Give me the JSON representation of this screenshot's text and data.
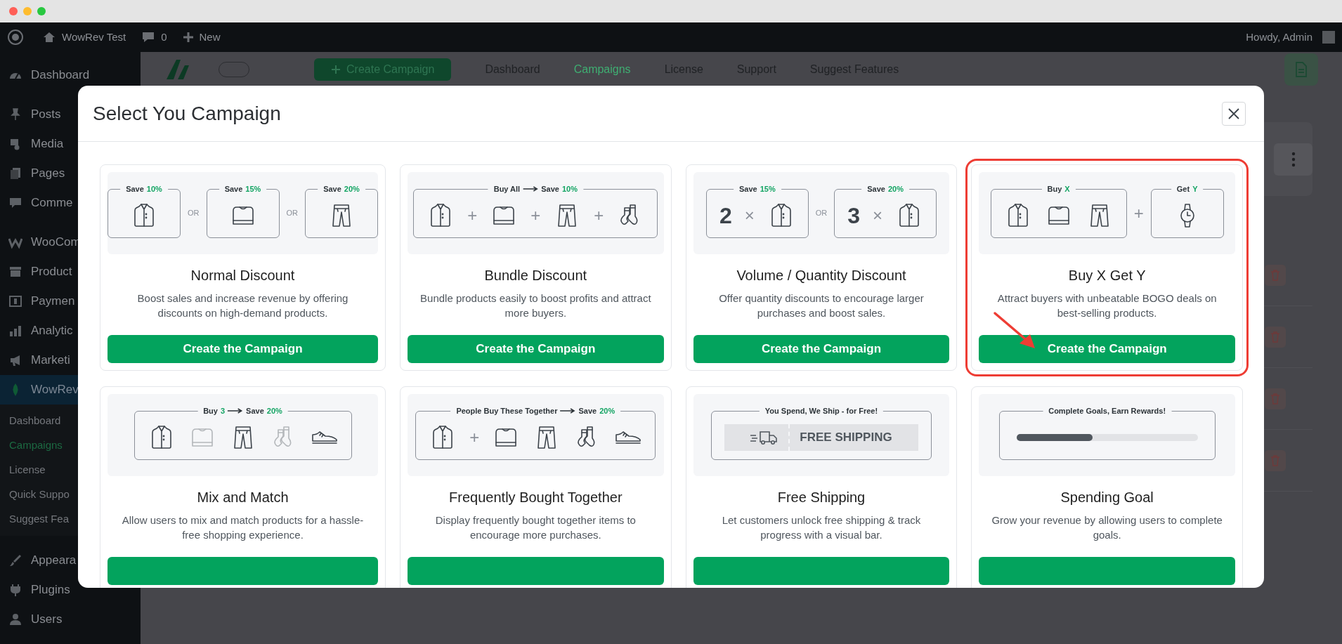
{
  "admin_bar": {
    "site_name": "WowRev Test",
    "comments_count": "0",
    "new_label": "New",
    "greeting": "Howdy, Admin"
  },
  "sidebar": {
    "groups": [
      {
        "items": [
          {
            "label": "Dashboard",
            "selected": false
          }
        ]
      },
      {
        "items": [
          {
            "label": "Posts",
            "selected": false
          },
          {
            "label": "Media",
            "selected": false
          },
          {
            "label": "Pages",
            "selected": false
          },
          {
            "label": "Comme",
            "selected": false
          }
        ]
      },
      {
        "items": [
          {
            "label": "WooCom",
            "selected": false
          },
          {
            "label": "Product",
            "selected": false
          },
          {
            "label": "Paymen",
            "selected": false
          },
          {
            "label": "Analytic",
            "selected": false
          },
          {
            "label": "Marketi",
            "selected": false
          },
          {
            "label": "WowRev",
            "selected": true,
            "children": [
              {
                "label": "Dashboard",
                "selected": false
              },
              {
                "label": "Campaigns",
                "selected": true
              },
              {
                "label": "License",
                "selected": false
              },
              {
                "label": "Quick Suppo",
                "selected": false
              },
              {
                "label": "Suggest Fea",
                "selected": false
              }
            ]
          }
        ]
      },
      {
        "items": [
          {
            "label": "Appeara",
            "selected": false
          },
          {
            "label": "Plugins",
            "selected": false
          },
          {
            "label": "Users",
            "selected": false
          }
        ]
      }
    ]
  },
  "page_header": {
    "create_button": "Create Campaign",
    "nav": [
      {
        "label": "Dashboard",
        "selected": false
      },
      {
        "label": "Campaigns",
        "selected": true
      },
      {
        "label": "License",
        "selected": false
      },
      {
        "label": "Support",
        "selected": false
      },
      {
        "label": "Suggest Features",
        "selected": false
      }
    ]
  },
  "modal": {
    "title": "Select You Campaign",
    "cards": [
      {
        "title": "Normal Discount",
        "description": "Boost sales and increase revenue by offering discounts on high-demand products.",
        "button_label": "Create the Campaign",
        "highlighted": false,
        "illustration": {
          "frames": [
            {
              "legend": [
                {
                  "kind": "text",
                  "text": "Save"
                },
                {
                  "kind": "accent",
                  "text": "10%"
                }
              ],
              "items": [
                {
                  "kind": "shirt"
                }
              ]
            },
            {
              "joiner": "OR",
              "legend": [
                {
                  "kind": "text",
                  "text": "Save"
                },
                {
                  "kind": "accent",
                  "text": "15%"
                }
              ],
              "items": [
                {
                  "kind": "sweater"
                }
              ]
            },
            {
              "joiner": "OR",
              "legend": [
                {
                  "kind": "text",
                  "text": "Save"
                },
                {
                  "kind": "accent",
                  "text": "20%"
                }
              ],
              "items": [
                {
                  "kind": "pants"
                }
              ]
            }
          ]
        }
      },
      {
        "title": "Bundle Discount",
        "description": "Bundle products easily to boost profits and attract more buyers.",
        "button_label": "Create the Campaign",
        "highlighted": false,
        "illustration": {
          "frames": [
            {
              "legend": [
                {
                  "kind": "text",
                  "text": "Buy All"
                },
                {
                  "kind": "arrow"
                },
                {
                  "kind": "text",
                  "text": "Save"
                },
                {
                  "kind": "accent",
                  "text": "10%"
                }
              ],
              "items": [
                {
                  "kind": "shirt"
                },
                {
                  "kind": "sign",
                  "text": "+"
                },
                {
                  "kind": "sweater"
                },
                {
                  "kind": "sign",
                  "text": "+"
                },
                {
                  "kind": "pants"
                },
                {
                  "kind": "sign",
                  "text": "+"
                },
                {
                  "kind": "socks"
                }
              ]
            }
          ]
        }
      },
      {
        "title": "Volume / Quantity Discount",
        "description": "Offer quantity discounts to encourage larger purchases and boost sales.",
        "button_label": "Create the Campaign",
        "highlighted": false,
        "illustration": {
          "frames": [
            {
              "legend": [
                {
                  "kind": "text",
                  "text": "Save"
                },
                {
                  "kind": "accent",
                  "text": "15%"
                }
              ],
              "items": [
                {
                  "kind": "count",
                  "text": "2"
                },
                {
                  "kind": "sign",
                  "text": "×"
                },
                {
                  "kind": "shirt"
                }
              ]
            },
            {
              "joiner": "OR",
              "legend": [
                {
                  "kind": "text",
                  "text": "Save"
                },
                {
                  "kind": "accent",
                  "text": "20%"
                }
              ],
              "items": [
                {
                  "kind": "count",
                  "text": "3"
                },
                {
                  "kind": "sign",
                  "text": "×"
                },
                {
                  "kind": "shirt"
                }
              ]
            }
          ]
        }
      },
      {
        "title": "Buy X Get Y",
        "description": "Attract buyers with unbeatable BOGO deals on best-selling products.",
        "button_label": "Create the Campaign",
        "highlighted": true,
        "illustration": {
          "frames": [
            {
              "legend": [
                {
                  "kind": "text",
                  "text": "Buy"
                },
                {
                  "kind": "accent",
                  "text": "X"
                }
              ],
              "items": [
                {
                  "kind": "shirt"
                },
                {
                  "kind": "sweater"
                },
                {
                  "kind": "pants"
                }
              ]
            },
            {
              "joiner": "+",
              "legend": [
                {
                  "kind": "text",
                  "text": "Get"
                },
                {
                  "kind": "accent",
                  "text": "Y"
                }
              ],
              "items": [
                {
                  "kind": "watch"
                }
              ]
            }
          ]
        }
      },
      {
        "title": "Mix and Match",
        "description": "Allow users to mix and match products for a hassle-free shopping experience.",
        "highlighted": false,
        "illustration": {
          "frames": [
            {
              "legend": [
                {
                  "kind": "text",
                  "text": "Buy"
                },
                {
                  "kind": "accent",
                  "text": "3"
                },
                {
                  "kind": "arrow"
                },
                {
                  "kind": "text",
                  "text": "Save"
                },
                {
                  "kind": "accent",
                  "text": "20%"
                }
              ],
              "items": [
                {
                  "kind": "shirt",
                  "faded": false
                },
                {
                  "kind": "sweater",
                  "faded": true
                },
                {
                  "kind": "pants",
                  "faded": false
                },
                {
                  "kind": "socks",
                  "faded": true
                },
                {
                  "kind": "shoe",
                  "faded": false
                }
              ]
            }
          ]
        }
      },
      {
        "title": "Frequently Bought Together",
        "description": "Display frequently bought together items to encourage more purchases.",
        "highlighted": false,
        "illustration": {
          "frames": [
            {
              "legend": [
                {
                  "kind": "text",
                  "text": "People Buy These Together"
                },
                {
                  "kind": "arrow"
                },
                {
                  "kind": "text",
                  "text": "Save"
                },
                {
                  "kind": "accent",
                  "text": "20%"
                }
              ],
              "items": [
                {
                  "kind": "shirt"
                },
                {
                  "kind": "sign",
                  "text": "+"
                },
                {
                  "kind": "sweater"
                },
                {
                  "kind": "pants"
                },
                {
                  "kind": "socks"
                },
                {
                  "kind": "shoe"
                }
              ]
            }
          ]
        }
      },
      {
        "title": "Free Shipping",
        "description": "Let customers unlock free shipping & track progress with a visual bar.",
        "highlighted": false,
        "illustration": {
          "frames": [
            {
              "legend": [
                {
                  "kind": "text",
                  "text": "You Spend, We Ship - for Free!"
                }
              ],
              "items": [
                {
                  "kind": "shipping",
                  "text": "FREE SHIPPING"
                }
              ]
            }
          ]
        }
      },
      {
        "title": "Spending Goal",
        "description": "Grow your revenue by allowing users to complete goals.",
        "highlighted": false,
        "illustration": {
          "frames": [
            {
              "legend": [
                {
                  "kind": "text",
                  "text": "Complete Goals, Earn Rewards!"
                }
              ],
              "items": [
                {
                  "kind": "progress",
                  "level": 0.42
                }
              ]
            }
          ]
        }
      }
    ]
  }
}
